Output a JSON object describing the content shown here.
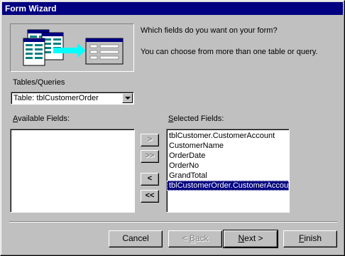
{
  "window": {
    "title": "Form Wizard"
  },
  "intro": {
    "question": "Which fields do you want on your form?",
    "hint": "You can choose from more than one table or query."
  },
  "tables": {
    "label": "Tables/Queries",
    "selected": "Table: tblCustomerOrder"
  },
  "available": {
    "label_pre": "",
    "label_u": "A",
    "label_post": "vailable Fields:",
    "items": []
  },
  "selected": {
    "label_u": "S",
    "label_post": "elected Fields:",
    "items": [
      "tblCustomer.CustomerAccount",
      "CustomerName",
      "OrderDate",
      "OrderNo",
      "GrandTotal",
      "tblCustomerOrder.CustomerAccount"
    ],
    "selected_index": 5
  },
  "move_buttons": {
    "add_one": ">",
    "add_all": ">>",
    "remove_one": "<",
    "remove_all": "<<"
  },
  "footer": {
    "cancel": "Cancel",
    "back_u": "B",
    "back_pre": "< ",
    "back_post": "ack",
    "next_u": "N",
    "next_post": "ext >",
    "finish_u": "F",
    "finish_post": "inish"
  },
  "colors": {
    "title_bar": "#000080",
    "face": "#c0c0c0",
    "selection": "#000080",
    "arrow": "#00ffff"
  }
}
